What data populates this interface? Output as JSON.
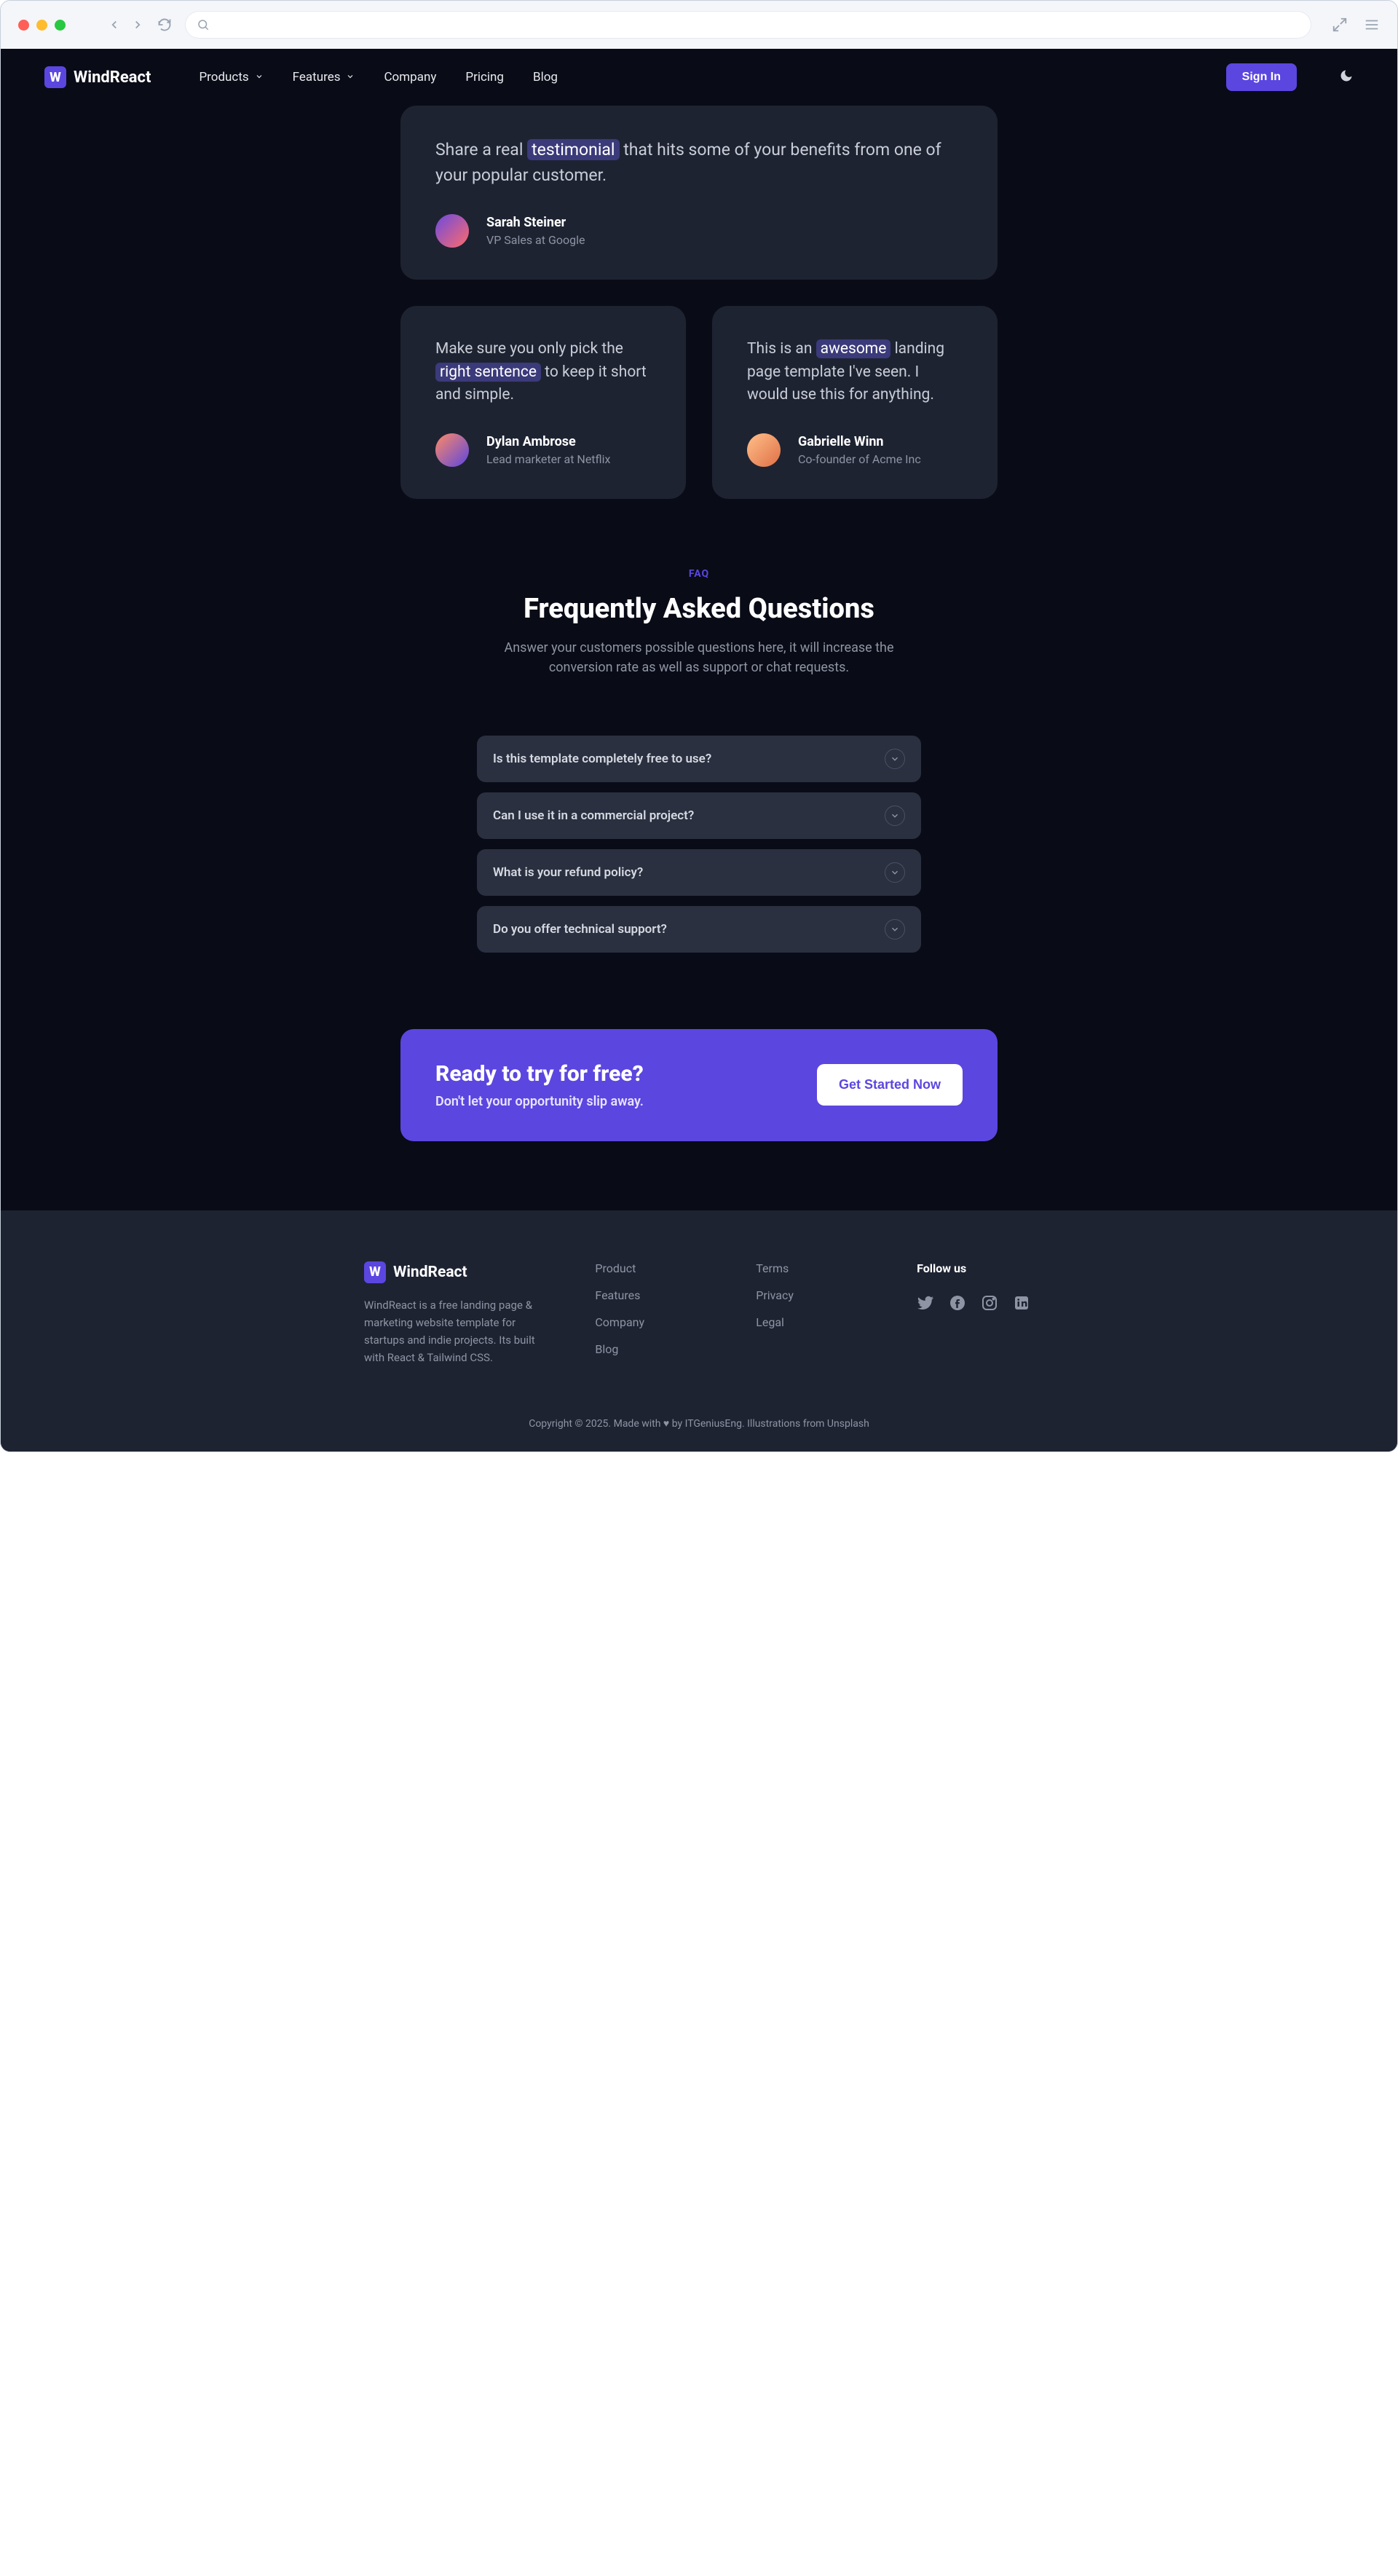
{
  "brand": {
    "logo_letter": "W",
    "name": "WindReact"
  },
  "nav": {
    "items": [
      {
        "label": "Products",
        "has_dropdown": true
      },
      {
        "label": "Features",
        "has_dropdown": true
      },
      {
        "label": "Company",
        "has_dropdown": false
      },
      {
        "label": "Pricing",
        "has_dropdown": false
      },
      {
        "label": "Blog",
        "has_dropdown": false
      }
    ],
    "signin": "Sign In"
  },
  "testimonials": {
    "t1": {
      "pre": "Share a real ",
      "mark": "testimonial",
      "post": " that hits some of your benefits from one of your popular customer.",
      "name": "Sarah Steiner",
      "role": "VP Sales at Google"
    },
    "t2": {
      "pre": "Make sure you only pick the ",
      "mark": "right sentence",
      "post": " to keep it short and simple.",
      "name": "Dylan Ambrose",
      "role": "Lead marketer at Netflix"
    },
    "t3": {
      "pre": "This is an ",
      "mark": "awesome",
      "post": " landing page template I've seen. I would use this for anything.",
      "name": "Gabrielle Winn",
      "role": "Co-founder of Acme Inc"
    }
  },
  "faq": {
    "pretitle": "FAQ",
    "title": "Frequently Asked Questions",
    "subtitle": "Answer your customers possible questions here, it will increase the conversion rate as well as support or chat requests.",
    "items": [
      {
        "q": "Is this template completely free to use?"
      },
      {
        "q": "Can I use it in a commercial project?"
      },
      {
        "q": "What is your refund policy?"
      },
      {
        "q": "Do you offer technical support?"
      }
    ]
  },
  "cta": {
    "title": "Ready to try for free?",
    "subtitle": "Don't let your opportunity slip away.",
    "button": "Get Started Now"
  },
  "footer": {
    "desc": "WindReact is a free landing page & marketing website template for startups and indie projects. Its built with React & Tailwind CSS.",
    "col1": [
      "Product",
      "Features",
      "Company",
      "Blog"
    ],
    "col2": [
      "Terms",
      "Privacy",
      "Legal"
    ],
    "follow": "Follow us",
    "copyright": "Copyright © 2025. Made with ♥ by ITGeniusEng. Illustrations from Unsplash"
  }
}
